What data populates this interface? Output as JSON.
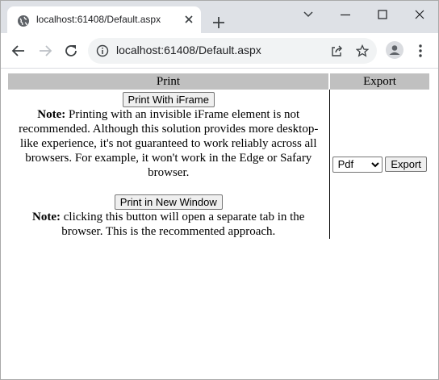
{
  "browser": {
    "tab_title": "localhost:61408/Default.aspx",
    "url": "localhost:61408/Default.aspx"
  },
  "page": {
    "headers": {
      "print": "Print",
      "export": "Export"
    },
    "iframe_button": "Print With iFrame",
    "iframe_note_label": "Note:",
    "iframe_note_text": " Printing with an invisible iFrame element is not recommended. Although this solution provides more desktop-like experience, it's not guaranteed to work reliably across all browsers. For example, it won't work in the Edge or Safary browser.",
    "window_button": "Print in New Window",
    "window_note_label": "Note:",
    "window_note_text": " clicking this button will open a separate tab in the browser. This is the recommented approach.",
    "export_format": "Pdf",
    "export_options": [
      "Pdf"
    ],
    "export_button": "Export"
  },
  "icons": {
    "favicon": "globe-icon",
    "tab_close": "close-icon",
    "new_tab": "plus-icon",
    "tab_search": "chevron-down-icon",
    "minimize": "minimize-icon",
    "maximize": "maximize-icon",
    "close_window": "close-window-icon",
    "back": "back-arrow-icon",
    "forward": "forward-arrow-icon",
    "reload": "reload-icon",
    "site_info": "info-icon",
    "share": "share-icon",
    "bookmark": "star-icon",
    "profile": "profile-icon",
    "menu": "menu-dots-icon"
  }
}
